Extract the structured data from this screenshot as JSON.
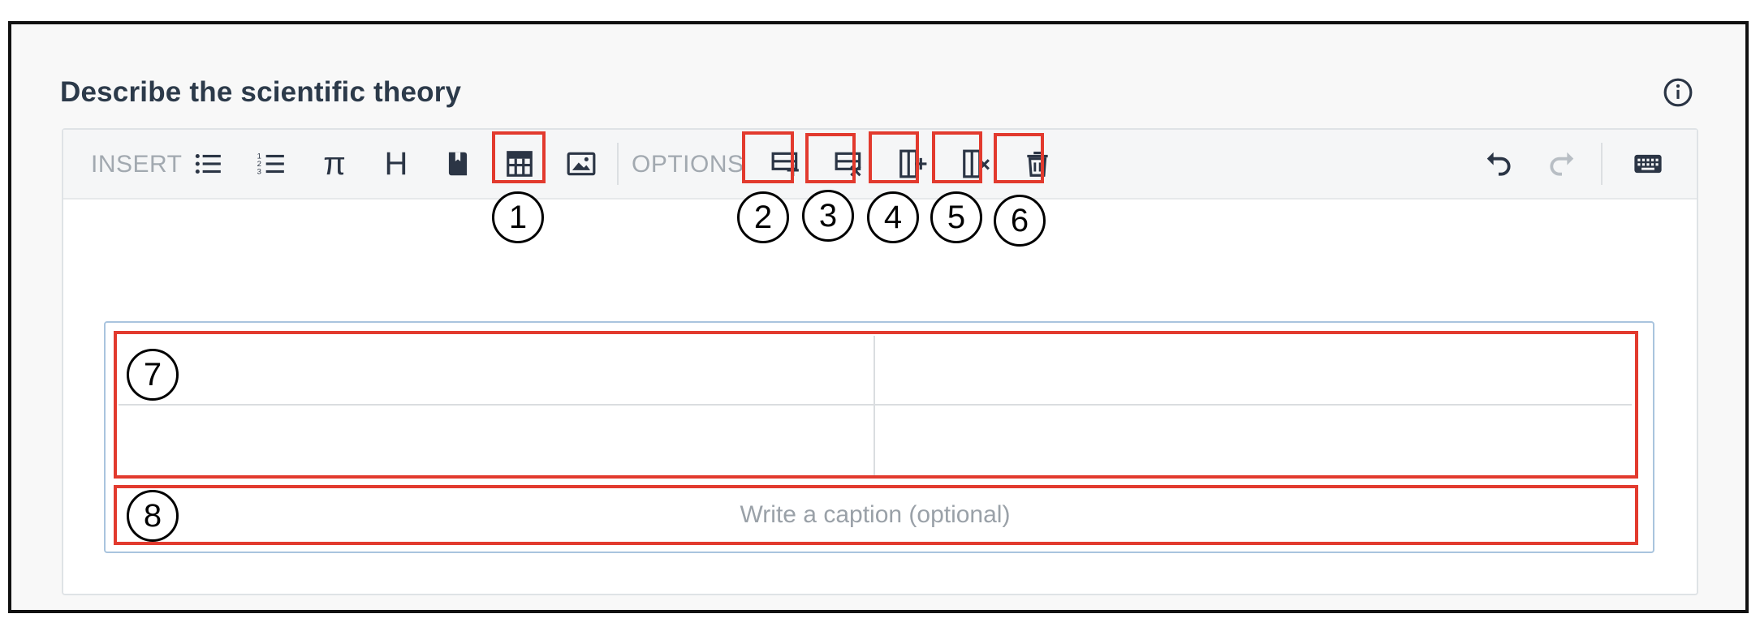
{
  "form": {
    "title": "Describe the scientific theory"
  },
  "toolbar": {
    "insert_label": "INSERT",
    "options_label": "OPTIONS",
    "insert_buttons": [
      {
        "name": "bulleted-list",
        "icon": "bullet-list-icon"
      },
      {
        "name": "numbered-list",
        "icon": "numbered-list-icon"
      },
      {
        "name": "math",
        "icon": "pi-icon",
        "glyph": "π"
      },
      {
        "name": "heading",
        "icon": "heading-icon",
        "glyph": "H"
      },
      {
        "name": "citation",
        "icon": "bookmark-icon"
      },
      {
        "name": "table",
        "icon": "table-icon"
      },
      {
        "name": "image",
        "icon": "image-icon"
      }
    ],
    "option_buttons": [
      {
        "name": "add-row",
        "icon": "add-row-icon"
      },
      {
        "name": "delete-row",
        "icon": "delete-row-icon"
      },
      {
        "name": "add-column",
        "icon": "add-column-icon"
      },
      {
        "name": "delete-column",
        "icon": "delete-column-icon"
      },
      {
        "name": "delete-table",
        "icon": "trash-icon"
      }
    ],
    "right_buttons": [
      {
        "name": "undo",
        "icon": "undo-icon"
      },
      {
        "name": "redo",
        "icon": "redo-icon"
      },
      {
        "name": "keyboard",
        "icon": "keyboard-icon"
      }
    ]
  },
  "table": {
    "rows": [
      [
        "",
        ""
      ],
      [
        "",
        ""
      ]
    ],
    "caption_placeholder": "Write a caption (optional)"
  },
  "callouts": [
    "1",
    "2",
    "3",
    "4",
    "5",
    "6",
    "7",
    "8"
  ],
  "colors": {
    "highlight": "#e23a2e",
    "title": "#2c3a4a",
    "toolbar_label": "#a2a9b0",
    "icon": "#2b3545",
    "table_border": "#a9c4de"
  }
}
